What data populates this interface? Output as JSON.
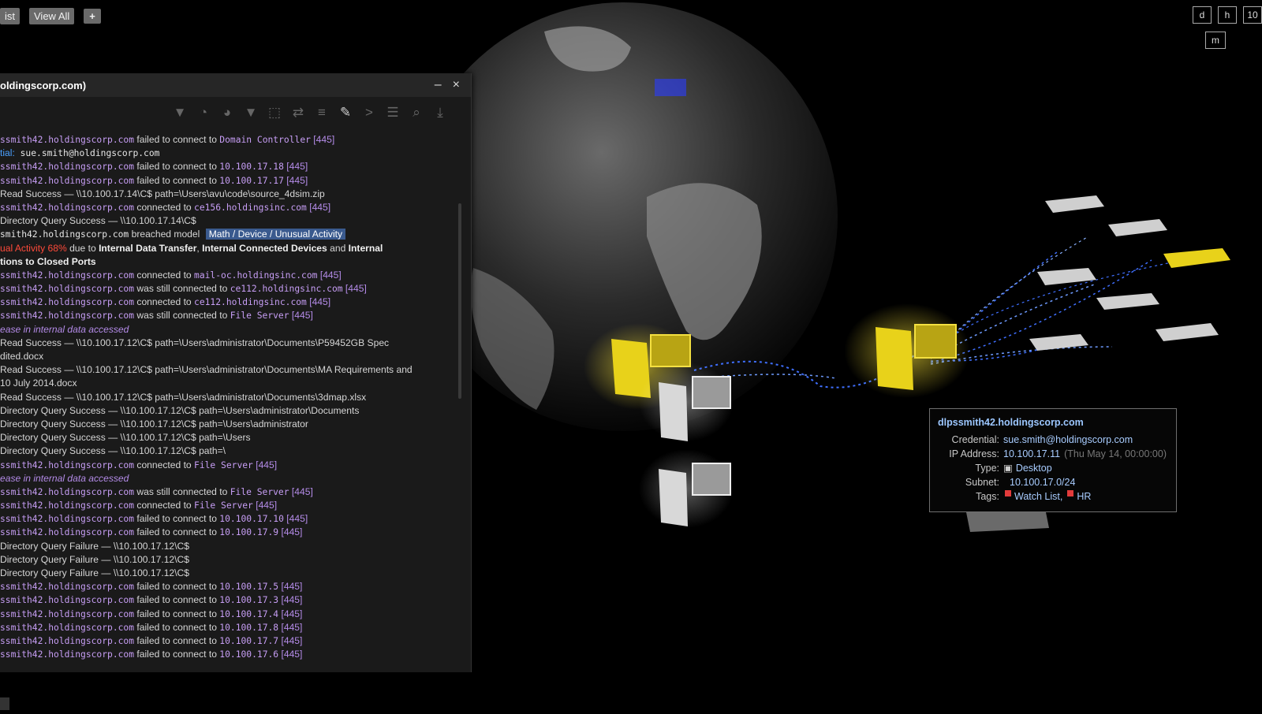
{
  "topbar": {
    "list_label": "ist",
    "view_all_label": "View All",
    "add_label": "+"
  },
  "top_right_buttons": {
    "d": "d",
    "h": "h",
    "n": "10",
    "m": "m"
  },
  "panel": {
    "title": "oldingscorp.com)",
    "minimize": "–",
    "close": "×",
    "toolbar_icons": [
      "filter-dim-icon",
      "clock-icon",
      "clock-alt-icon",
      "filter-icon",
      "export-icon",
      "swap-icon",
      "list-icon",
      "brush-icon",
      "chevron-right-icon",
      "columns-icon",
      "search-icon",
      "download-icon"
    ],
    "log": [
      {
        "p": "ssmith42.holdingscorp.com",
        "a": " failed to connect to ",
        "b": "Domain Controller",
        "c": " [445]"
      },
      {
        "k": "tial:",
        "b": " sue.smith@holdingscorp.com"
      },
      {
        "p": "ssmith42.holdingscorp.com",
        "a": " failed to connect to ",
        "b": "10.100.17.18",
        "c": " [445]"
      },
      {
        "p": "ssmith42.holdingscorp.com",
        "a": " failed to connect to ",
        "b": "10.100.17.17",
        "c": " [445]"
      },
      {
        "t": "Read Success — \\\\10.100.17.14\\C$ path=\\Users\\avu\\code\\source_4dsim.zip"
      },
      {
        "p": "ssmith42.holdingscorp.com",
        "a": " connected to ",
        "b": "ce156.holdingsinc.com",
        "c": " [445]"
      },
      {
        "t": "Directory Query Success — \\\\10.100.17.14\\C$"
      },
      {
        "m": "smith42.holdingscorp.com",
        "a": " breached model ",
        "tag": "Math / Device / Unusual Activity"
      },
      {
        "r": "ual Activity 68%",
        "a": " due to ",
        "x": "Internal Data Transfer",
        ",": ", ",
        "y": "Internal Connected Devices",
        "and": " and ",
        "z": "Internal"
      },
      {
        "w": "tions to Closed Ports"
      },
      {
        "p": "ssmith42.holdingscorp.com",
        "a": " connected to ",
        "b": "mail-oc.holdingsinc.com",
        "c": " [445]"
      },
      {
        "p": "ssmith42.holdingscorp.com",
        "a": " was still connected to ",
        "b": "ce112.holdingsinc.com",
        "c": " [445]"
      },
      {
        "p": "ssmith42.holdingscorp.com",
        "a": " connected to ",
        "b": "ce112.holdingsinc.com",
        "c": " [445]"
      },
      {
        "p": "ssmith42.holdingscorp.com",
        "a": " was still connected to ",
        "b": "File Server",
        "c": " [445]"
      },
      {
        "n": "ease in internal data accessed"
      },
      {
        "t": "Read Success — \\\\10.100.17.12\\C$ path=\\Users\\administrator\\Documents\\P59452GB Spec"
      },
      {
        "t": "dited.docx"
      },
      {
        "t": "Read Success — \\\\10.100.17.12\\C$ path=\\Users\\administrator\\Documents\\MA Requirements and"
      },
      {
        "t": "10 July 2014.docx"
      },
      {
        "t": "Read Success — \\\\10.100.17.12\\C$ path=\\Users\\administrator\\Documents\\3dmap.xlsx"
      },
      {
        "t": "Directory Query Success — \\\\10.100.17.12\\C$ path=\\Users\\administrator\\Documents"
      },
      {
        "t": "Directory Query Success — \\\\10.100.17.12\\C$ path=\\Users\\administrator"
      },
      {
        "t": "Directory Query Success — \\\\10.100.17.12\\C$ path=\\Users"
      },
      {
        "t": "Directory Query Success — \\\\10.100.17.12\\C$ path=\\"
      },
      {
        "p": "ssmith42.holdingscorp.com",
        "a": " connected to ",
        "b": "File Server",
        "c": " [445]"
      },
      {
        "n": "ease in internal data accessed"
      },
      {
        "p": "ssmith42.holdingscorp.com",
        "a": " was still connected to ",
        "b": "File Server",
        "c": " [445]"
      },
      {
        "p": "ssmith42.holdingscorp.com",
        "a": " connected to ",
        "b": "File Server",
        "c": " [445]"
      },
      {
        "p": "ssmith42.holdingscorp.com",
        "a": " failed to connect to ",
        "b": "10.100.17.10",
        "c": " [445]"
      },
      {
        "p": "ssmith42.holdingscorp.com",
        "a": " failed to connect to ",
        "b": "10.100.17.9",
        "c": " [445]"
      },
      {
        "t": "Directory Query Failure — \\\\10.100.17.12\\C$"
      },
      {
        "t": "Directory Query Failure — \\\\10.100.17.12\\C$"
      },
      {
        "t": "Directory Query Failure — \\\\10.100.17.12\\C$"
      },
      {
        "p": "ssmith42.holdingscorp.com",
        "a": " failed to connect to ",
        "b": "10.100.17.5",
        "c": " [445]"
      },
      {
        "p": "ssmith42.holdingscorp.com",
        "a": " failed to connect to ",
        "b": "10.100.17.3",
        "c": " [445]"
      },
      {
        "p": "ssmith42.holdingscorp.com",
        "a": " failed to connect to ",
        "b": "10.100.17.4",
        "c": " [445]"
      },
      {
        "p": "ssmith42.holdingscorp.com",
        "a": " failed to connect to ",
        "b": "10.100.17.8",
        "c": " [445]"
      },
      {
        "p": "ssmith42.holdingscorp.com",
        "a": " failed to connect to ",
        "b": "10.100.17.7",
        "c": " [445]"
      },
      {
        "p": "ssmith42.holdingscorp.com",
        "a": " failed to connect to ",
        "b": "10.100.17.6",
        "c": " [445]"
      }
    ]
  },
  "tooltip": {
    "title": "dlpssmith42.holdingscorp.com",
    "credential_label": "Credential:",
    "credential": "sue.smith@holdingscorp.com",
    "ip_label": "IP Address:",
    "ip": "10.100.17.11",
    "ip_time": "(Thu May 14, 00:00:00)",
    "type_label": "Type:",
    "type": "Desktop",
    "subnet_label": "Subnet:",
    "subnet": "10.100.17.0/24",
    "tags_label": "Tags:",
    "tag1": "Watch List,",
    "tag2": "HR"
  },
  "colors": {
    "highlight": "#e8d21a",
    "accent": "#4aa0ff",
    "host": "#c79ef5",
    "alert": "#ff4a3a"
  }
}
